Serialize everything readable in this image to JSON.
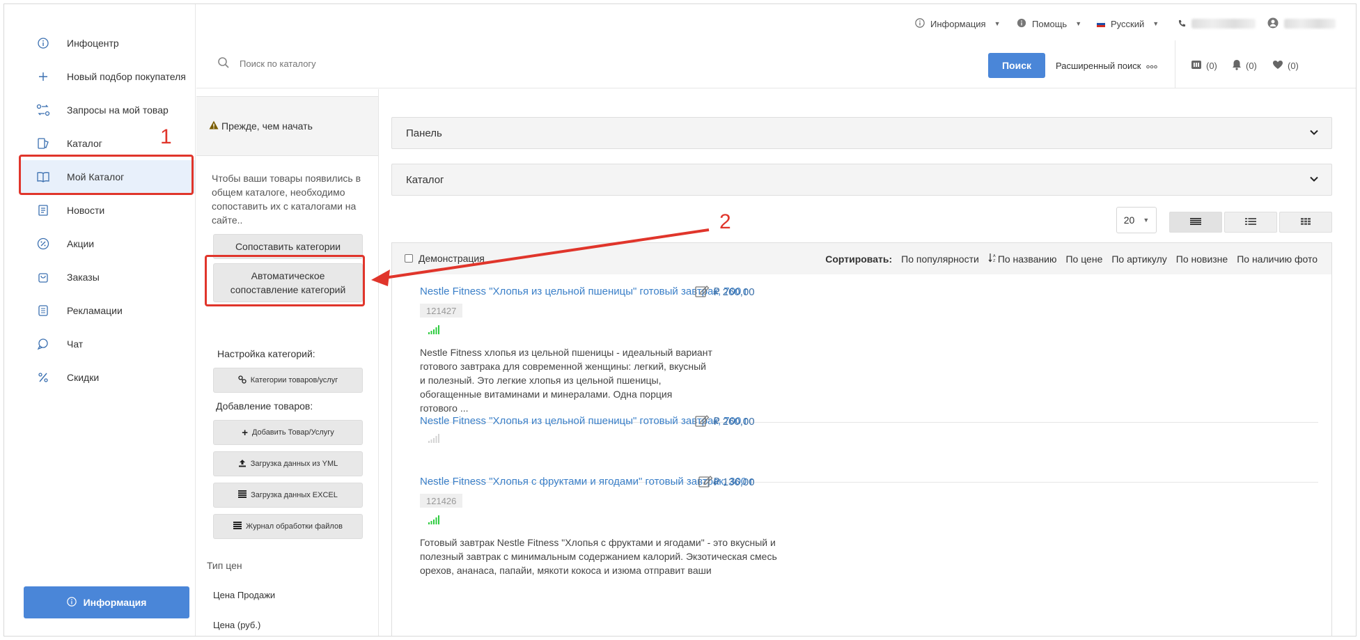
{
  "sidebar": {
    "items": [
      {
        "label": "Инфоцентр",
        "icon": "info-icon"
      },
      {
        "label": "Новый подбор покупателя",
        "icon": "plus-icon"
      },
      {
        "label": "Запросы на мой товар",
        "icon": "exchange-icon"
      },
      {
        "label": "Каталог",
        "icon": "catalog-icon"
      },
      {
        "label": "Мой Каталог",
        "icon": "book-icon"
      },
      {
        "label": "Новости",
        "icon": "news-icon"
      },
      {
        "label": "Акции",
        "icon": "discount-icon"
      },
      {
        "label": "Заказы",
        "icon": "bag-icon"
      },
      {
        "label": "Рекламации",
        "icon": "claims-icon"
      },
      {
        "label": "Чат",
        "icon": "chat-icon"
      },
      {
        "label": "Скидки",
        "icon": "percent-icon"
      }
    ],
    "active_index": 4,
    "info_button": "Информация"
  },
  "topbar": {
    "info": "Информация",
    "help": "Помощь",
    "language": "Русский"
  },
  "search": {
    "placeholder": "Поиск по каталогу",
    "button": "Поиск",
    "advanced": "Расширенный поиск",
    "compare_count": "(0)",
    "notify_count": "(0)",
    "fav_count": "(0)"
  },
  "panel": {
    "before_start": "Прежде, чем начать",
    "intro": "Чтобы ваши товары появились в общем каталоге, необходимо сопоставить их с каталогами на сайте..",
    "match_btn": "Сопоставить категории",
    "auto_match_line1": "Автоматическое",
    "auto_match_line2": "сопоставление категорий",
    "cat_settings": "Настройка категорий:",
    "cat_btn": "Категории товаров/услуг",
    "add_goods": "Добавление товаров:",
    "add_btn": "Добавить Товар/Услугу",
    "yml_btn": "Загрузка данных из YML",
    "excel_btn": "Загрузка данных EXCEL",
    "journal_btn": "Журнал обработки файлов",
    "price_type": "Тип цен",
    "price_sale": "Цена Продажи",
    "price_cut": "Цена (руб.)"
  },
  "main": {
    "panel_acc": "Панель",
    "catalog_acc": "Каталог",
    "page_size": "20",
    "demo": "Демонстрация",
    "sort_label": "Сортировать:",
    "sort_options": [
      "По популярности",
      "По названию",
      "По цене",
      "По артикулу",
      "По новизне",
      "По наличию фото"
    ]
  },
  "products": [
    {
      "title": "Nestle Fitness \"Хлопья из цельной пшеницы\" готовый завтрак, 700 г",
      "price": "₽ 260,00",
      "sku": "121427",
      "signal": "green",
      "description": "Nestle Fitness хлопья из цельной пшеницы - идеальный вариант готового завтрака для современной женщины: легкий, вкусный и полезный. Это легкие хлопья из цельной пшеницы, обогащенные витаминами и минералами. Одна порция готового ..."
    },
    {
      "title": "Nestle Fitness \"Хлопья из цельной пшеницы\" готовый завтрак, 700 г",
      "price": "₽ 260,00",
      "sku": "",
      "signal": "gray",
      "description": ""
    },
    {
      "title": "Nestle Fitness \"Хлопья с фруктами и ягодами\" готовый завтрак, 300 г",
      "price": "₽ 136,00",
      "sku": "121426",
      "signal": "green",
      "description": "Готовый завтрак Nestle Fitness \"Хлопья с фруктами и ягодами\" - это вкусный и полезный завтрак с минимальным содержанием калорий. Экзотическая смесь орехов, ананаса, папайи, мякоти кокоса и изюма отправит ваши"
    }
  ],
  "annotations": {
    "one": "1",
    "two": "2"
  },
  "colors": {
    "accent": "#4a86d8",
    "annotation": "#e0352b",
    "link": "#3a7fc8",
    "signal_green": "#2ecc40"
  }
}
